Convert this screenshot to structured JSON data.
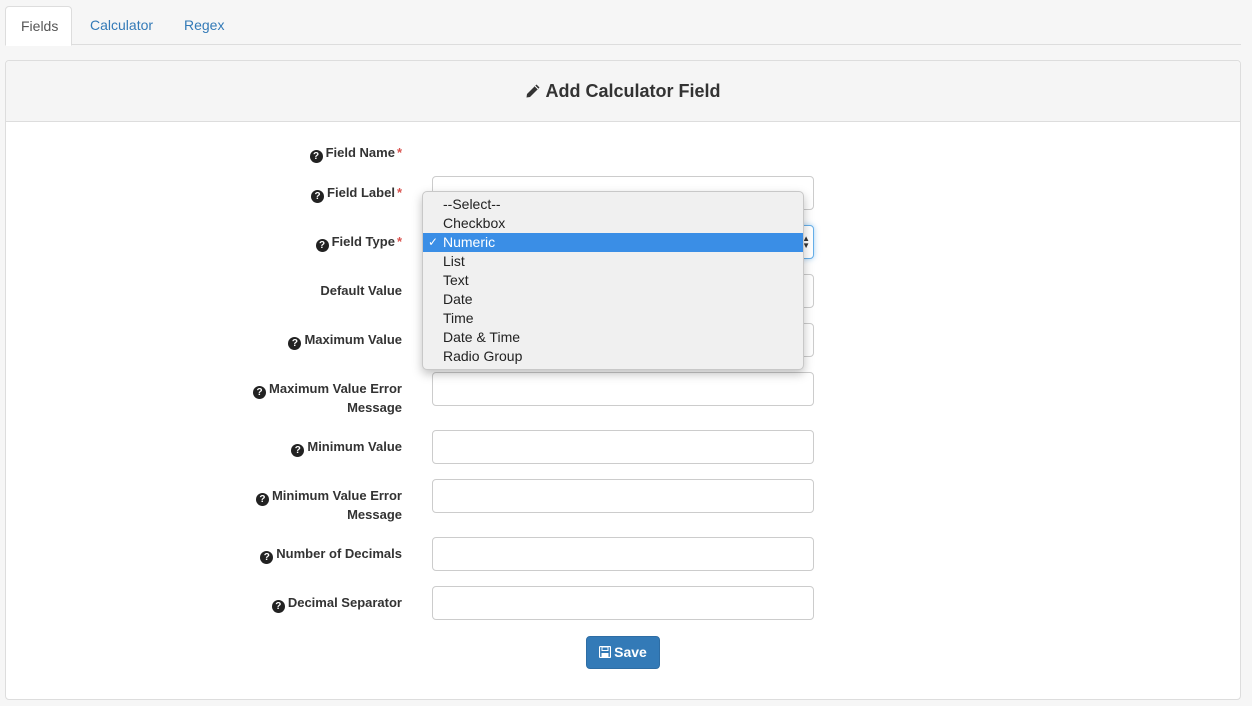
{
  "tabs": [
    {
      "label": "Fields",
      "active": true
    },
    {
      "label": "Calculator",
      "active": false
    },
    {
      "label": "Regex",
      "active": false
    }
  ],
  "panel": {
    "title": "Add Calculator Field",
    "title_icon": "pencil-icon"
  },
  "form": {
    "required_mark": "*",
    "help_glyph": "?",
    "fields": {
      "field_name": {
        "label": "Field Name"
      },
      "field_label": {
        "label": "Field Label"
      },
      "field_type": {
        "label": "Field Type"
      },
      "default_value": {
        "label": "Default Value"
      },
      "maximum_value": {
        "label": "Maximum Value"
      },
      "maximum_value_error": {
        "label": "Maximum Value Error Message"
      },
      "minimum_value": {
        "label": "Minimum Value"
      },
      "minimum_value_error": {
        "label": "Minimum Value Error Message"
      },
      "number_of_decimals": {
        "label": "Number of Decimals"
      },
      "decimal_separator": {
        "label": "Decimal Separator"
      }
    }
  },
  "field_type_dropdown": {
    "selected": "Numeric",
    "check_glyph": "✓",
    "options": [
      "--Select--",
      "Checkbox",
      "Numeric",
      "List",
      "Text",
      "Date",
      "Time",
      "Date & Time",
      "Radio Group"
    ]
  },
  "save_button": {
    "label": "Save",
    "icon": "floppy-disk-icon"
  },
  "colors": {
    "link": "#337ab7",
    "primary": "#337ab7",
    "required": "#d9534f",
    "selection": "#3a8ee6"
  }
}
